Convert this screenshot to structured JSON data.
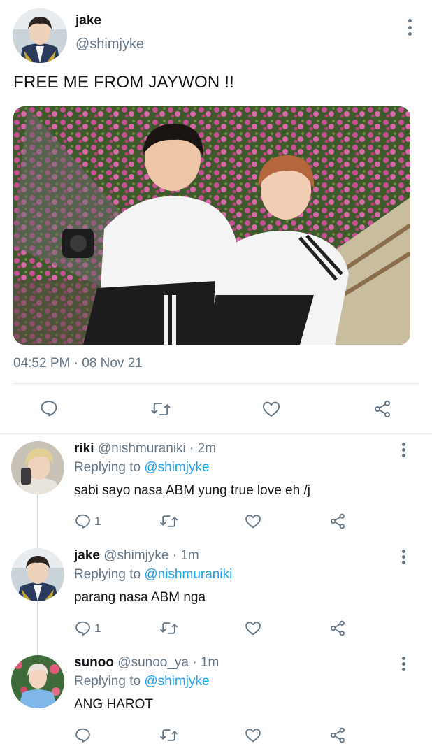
{
  "main_tweet": {
    "author_name": "jake",
    "author_handle": "@shimjyke",
    "text": "FREE ME FROM JAYWON !!",
    "timestamp": "04:52 PM · 08 Nov 21",
    "media_description_icon": "photo"
  },
  "replies": [
    {
      "name": "riki",
      "handle": "@nishmuraniki",
      "age": "2m",
      "replying_prefix": "Replying to",
      "replying_to": "@shimjyke",
      "text": "sabi sayo nasa ABM yung true love eh /j",
      "reply_count": "1"
    },
    {
      "name": "jake",
      "handle": "@shimjyke",
      "age": "1m",
      "replying_prefix": "Replying to",
      "replying_to": "@nishmuraniki",
      "text": "parang nasa ABM nga",
      "reply_count": "1"
    },
    {
      "name": "sunoo",
      "handle": "@sunoo_ya",
      "age": "1m",
      "replying_prefix": "Replying to",
      "replying_to": "@shimjyke",
      "text": "ANG HAROT",
      "reply_count": ""
    }
  ],
  "colors": {
    "text": "#14171a",
    "secondary": "#657786",
    "accent": "#1da1f2",
    "divider": "#e1e8ed"
  },
  "icons": [
    "more-vertical-icon",
    "reply-icon",
    "retweet-icon",
    "like-icon",
    "share-icon"
  ]
}
